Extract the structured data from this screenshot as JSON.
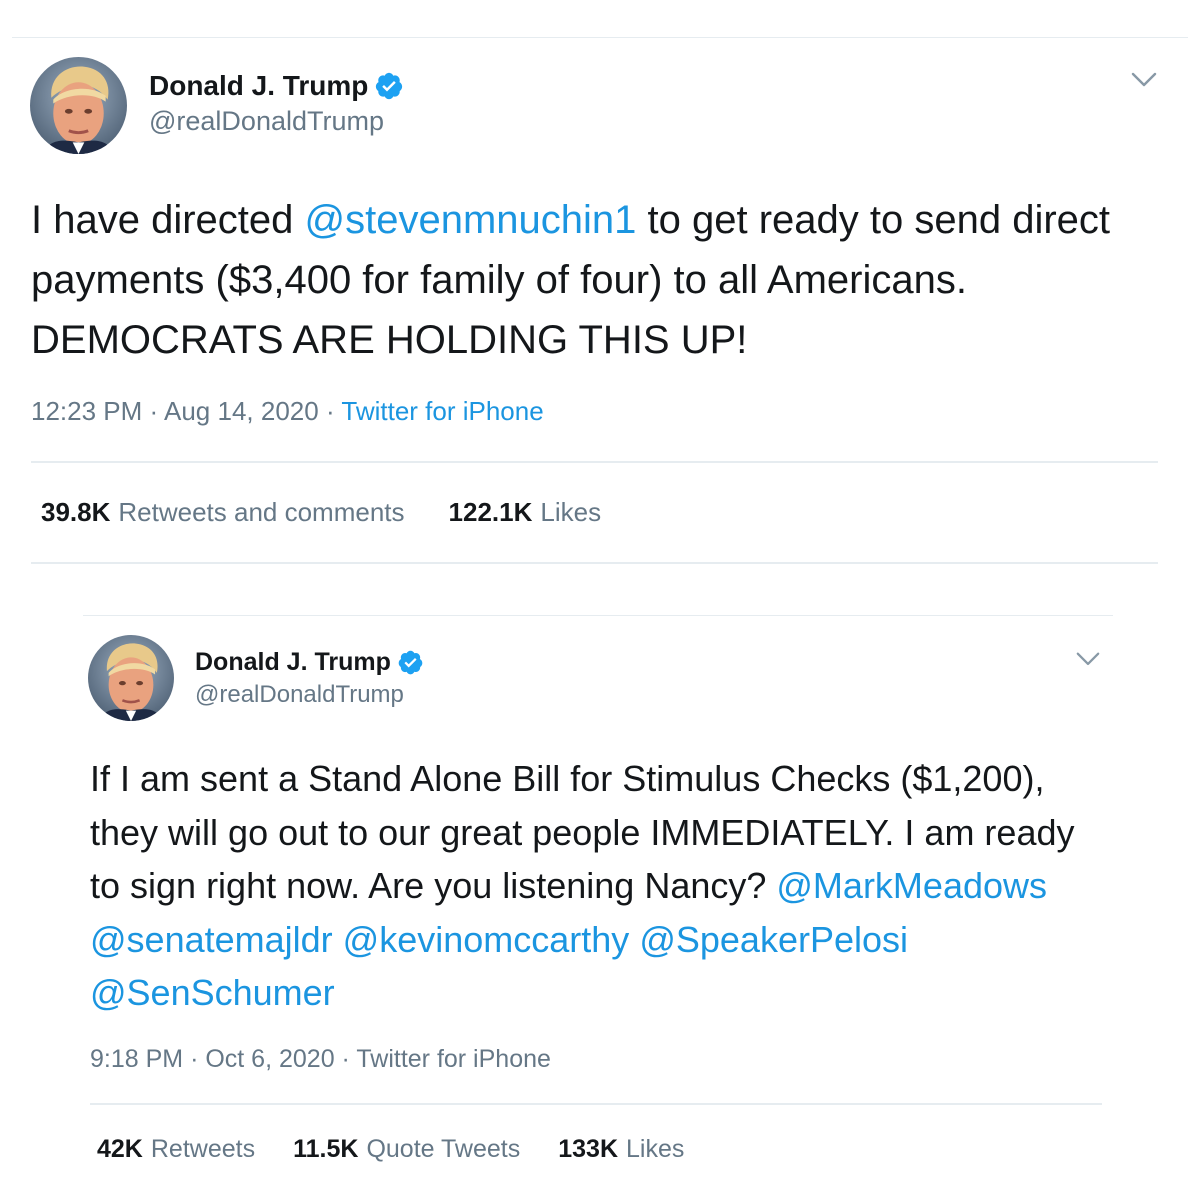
{
  "tweets": [
    {
      "author": {
        "display_name": "Donald J. Trump",
        "handle": "@realDonaldTrump",
        "verified": true
      },
      "text_segments": [
        {
          "type": "text",
          "value": "I have directed "
        },
        {
          "type": "mention",
          "value": "@stevenmnuchin1"
        },
        {
          "type": "text",
          "value": " to get ready to send direct payments ($3,400 for family of four) to all Americans. DEMOCRATS ARE HOLDING THIS UP!"
        }
      ],
      "meta": {
        "time": "12:23 PM",
        "separator": "·",
        "date": "Aug 14, 2020",
        "source": "Twitter for iPhone"
      },
      "stats": [
        {
          "count": "39.8K",
          "label": "Retweets and comments"
        },
        {
          "count": "122.1K",
          "label": "Likes"
        }
      ]
    },
    {
      "author": {
        "display_name": "Donald J. Trump",
        "handle": "@realDonaldTrump",
        "verified": true
      },
      "text_segments": [
        {
          "type": "text",
          "value": "If I am sent a Stand Alone Bill for Stimulus Checks ($1,200), they will go out to our great people IMMEDIATELY. I am ready to sign right now. Are you listening Nancy? "
        },
        {
          "type": "mention",
          "value": "@MarkMeadows"
        },
        {
          "type": "text",
          "value": " "
        },
        {
          "type": "mention",
          "value": "@senatemajldr"
        },
        {
          "type": "text",
          "value": " "
        },
        {
          "type": "mention",
          "value": "@kevinomccarthy"
        },
        {
          "type": "text",
          "value": " "
        },
        {
          "type": "mention",
          "value": "@SpeakerPelosi"
        },
        {
          "type": "text",
          "value": " "
        },
        {
          "type": "mention",
          "value": "@SenSchumer"
        }
      ],
      "meta": {
        "time": "9:18 PM",
        "separator": "·",
        "date": "Oct 6, 2020",
        "source": "Twitter for iPhone"
      },
      "stats": [
        {
          "count": "42K",
          "label": "Retweets"
        },
        {
          "count": "11.5K",
          "label": "Quote Tweets"
        },
        {
          "count": "133K",
          "label": "Likes"
        }
      ]
    }
  ],
  "icons": {
    "verified": "verified-badge-icon",
    "more": "chevron-down-icon"
  },
  "colors": {
    "text": "#14171a",
    "secondary": "#657786",
    "link": "#1b95e0",
    "verified": "#1da1f2",
    "divider": "#e6ecf0"
  }
}
